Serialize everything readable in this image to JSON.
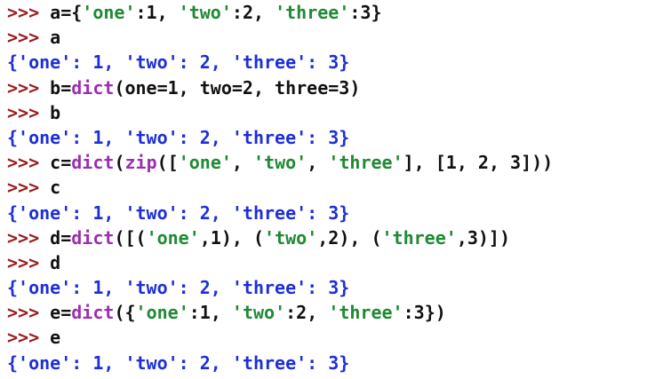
{
  "shell": {
    "prompt": ">>> ",
    "lines": [
      {
        "type": "input",
        "segments": [
          {
            "kind": "plain",
            "text": "a={"
          },
          {
            "kind": "string",
            "text": "'one'"
          },
          {
            "kind": "plain",
            "text": ":1, "
          },
          {
            "kind": "string",
            "text": "'two'"
          },
          {
            "kind": "plain",
            "text": ":2, "
          },
          {
            "kind": "string",
            "text": "'three'"
          },
          {
            "kind": "plain",
            "text": ":3}"
          }
        ]
      },
      {
        "type": "input",
        "segments": [
          {
            "kind": "plain",
            "text": "a"
          }
        ]
      },
      {
        "type": "output",
        "text": "{'one': 1, 'two': 2, 'three': 3}"
      },
      {
        "type": "input",
        "segments": [
          {
            "kind": "plain",
            "text": "b="
          },
          {
            "kind": "builtin",
            "text": "dict"
          },
          {
            "kind": "plain",
            "text": "(one=1, two=2, three=3)"
          }
        ]
      },
      {
        "type": "input",
        "segments": [
          {
            "kind": "plain",
            "text": "b"
          }
        ]
      },
      {
        "type": "output",
        "text": "{'one': 1, 'two': 2, 'three': 3}"
      },
      {
        "type": "input",
        "segments": [
          {
            "kind": "plain",
            "text": "c="
          },
          {
            "kind": "builtin",
            "text": "dict"
          },
          {
            "kind": "plain",
            "text": "("
          },
          {
            "kind": "builtin",
            "text": "zip"
          },
          {
            "kind": "plain",
            "text": "(["
          },
          {
            "kind": "string",
            "text": "'one'"
          },
          {
            "kind": "plain",
            "text": ", "
          },
          {
            "kind": "string",
            "text": "'two'"
          },
          {
            "kind": "plain",
            "text": ", "
          },
          {
            "kind": "string",
            "text": "'three'"
          },
          {
            "kind": "plain",
            "text": "], [1, 2, 3]))"
          }
        ]
      },
      {
        "type": "input",
        "segments": [
          {
            "kind": "plain",
            "text": "c"
          }
        ]
      },
      {
        "type": "output",
        "text": "{'one': 1, 'two': 2, 'three': 3}"
      },
      {
        "type": "input",
        "segments": [
          {
            "kind": "plain",
            "text": "d="
          },
          {
            "kind": "builtin",
            "text": "dict"
          },
          {
            "kind": "plain",
            "text": "([("
          },
          {
            "kind": "string",
            "text": "'one'"
          },
          {
            "kind": "plain",
            "text": ",1), ("
          },
          {
            "kind": "string",
            "text": "'two'"
          },
          {
            "kind": "plain",
            "text": ",2), ("
          },
          {
            "kind": "string",
            "text": "'three'"
          },
          {
            "kind": "plain",
            "text": ",3)])"
          }
        ]
      },
      {
        "type": "input",
        "segments": [
          {
            "kind": "plain",
            "text": "d"
          }
        ]
      },
      {
        "type": "output",
        "text": "{'one': 1, 'two': 2, 'three': 3}"
      },
      {
        "type": "input",
        "segments": [
          {
            "kind": "plain",
            "text": "e="
          },
          {
            "kind": "builtin",
            "text": "dict"
          },
          {
            "kind": "plain",
            "text": "({"
          },
          {
            "kind": "string",
            "text": "'one'"
          },
          {
            "kind": "plain",
            "text": ":1, "
          },
          {
            "kind": "string",
            "text": "'two'"
          },
          {
            "kind": "plain",
            "text": ":2, "
          },
          {
            "kind": "string",
            "text": "'three'"
          },
          {
            "kind": "plain",
            "text": ":3})"
          }
        ]
      },
      {
        "type": "input",
        "segments": [
          {
            "kind": "plain",
            "text": "e"
          }
        ]
      },
      {
        "type": "output",
        "text": "{'one': 1, 'two': 2, 'three': 3}"
      }
    ]
  },
  "colors": {
    "prompt": "#9b1c1c",
    "plain": "#111111",
    "builtin": "#9b2fae",
    "string": "#1f8a34",
    "output": "#1d2fd6",
    "background": "#ffffff"
  }
}
